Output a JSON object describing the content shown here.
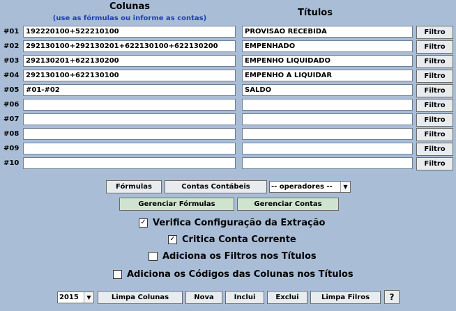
{
  "header": {
    "colunas": "Colunas",
    "colunas_hint": "(use as fórmulas ou informe as contas)",
    "titulos": "Títulos"
  },
  "rows": [
    {
      "label": "#01",
      "coluna": "192220100+522210100",
      "titulo": "PROVISAO RECEBIDA",
      "filtro": "Filtro"
    },
    {
      "label": "#02",
      "coluna": "292130100+292130201+622130100+622130200",
      "titulo": "EMPENHADO",
      "filtro": "Filtro"
    },
    {
      "label": "#03",
      "coluna": "292130201+622130200",
      "titulo": "EMPENHO LIQUIDADO",
      "filtro": "Filtro"
    },
    {
      "label": "#04",
      "coluna": "292130100+622130100",
      "titulo": "EMPENHO A LIQUIDAR",
      "filtro": "Filtro"
    },
    {
      "label": "#05",
      "coluna": "#01-#02",
      "titulo": "SALDO",
      "filtro": "Filtro"
    },
    {
      "label": "#06",
      "coluna": "",
      "titulo": "",
      "filtro": "Filtro"
    },
    {
      "label": "#07",
      "coluna": "",
      "titulo": "",
      "filtro": "Filtro"
    },
    {
      "label": "#08",
      "coluna": "",
      "titulo": "",
      "filtro": "Filtro"
    },
    {
      "label": "#09",
      "coluna": "",
      "titulo": "",
      "filtro": "Filtro"
    },
    {
      "label": "#10",
      "coluna": "",
      "titulo": "",
      "filtro": "Filtro"
    }
  ],
  "toolbar1": {
    "formulas": "Fórmulas",
    "contas_contabeis": "Contas Contábeis",
    "operadores": "-- operadores --"
  },
  "toolbar2": {
    "gerenciar_formulas": "Gerenciar Fórmulas",
    "gerenciar_contas": "Gerenciar Contas"
  },
  "options": [
    {
      "label": "Verifica Configuração da Extração",
      "checked": true
    },
    {
      "label": "Critica Conta Corrente",
      "checked": true
    },
    {
      "label": "Adiciona os Filtros nos Títulos",
      "checked": false
    },
    {
      "label": "Adiciona os Códigos das Colunas nos Títulos",
      "checked": false
    }
  ],
  "footer": {
    "year": "2015",
    "limpa_colunas": "Limpa Colunas",
    "nova": "Nova",
    "inclui": "Inclui",
    "exclui": "Exclui",
    "limpa_filtros": "Limpa Filros",
    "help": "?"
  },
  "colors": {
    "background": "#a9bdd6",
    "hint_text": "#1f3fb0",
    "green_button": "#cfe4cf"
  }
}
